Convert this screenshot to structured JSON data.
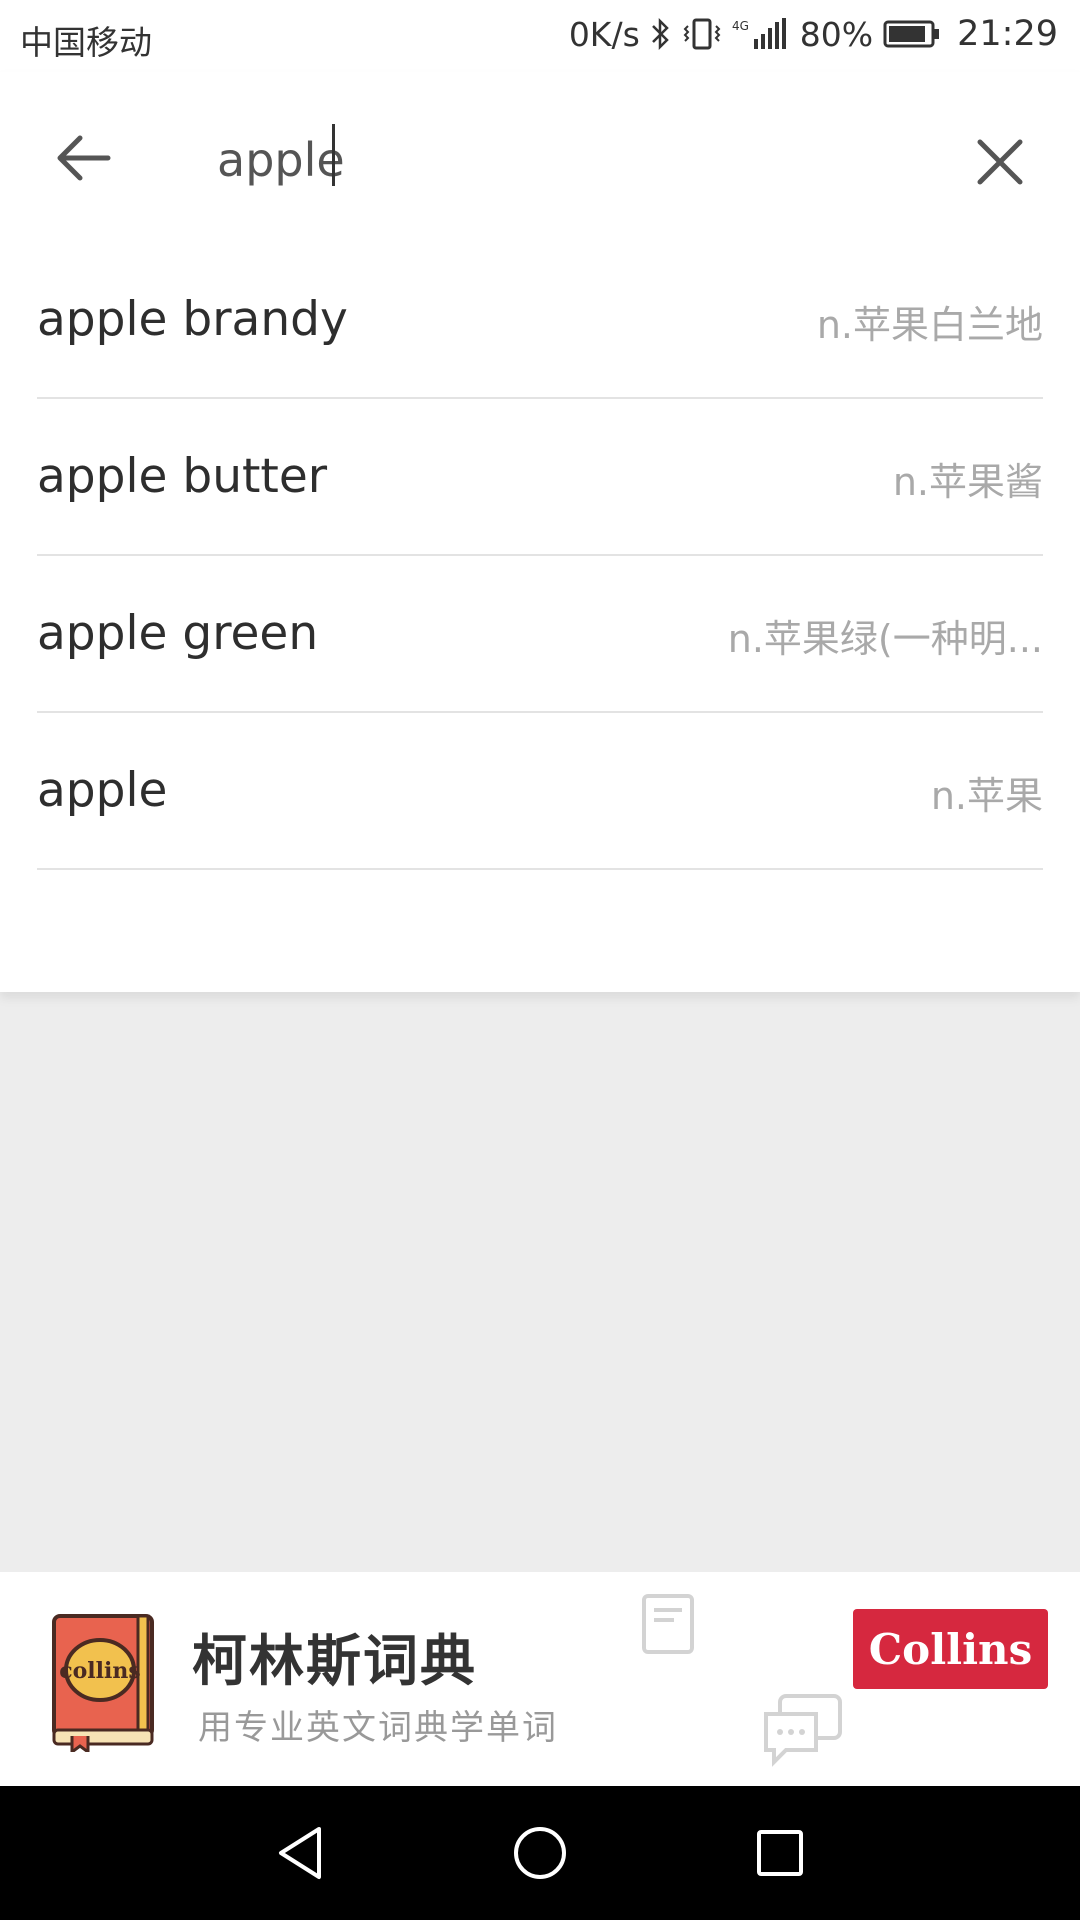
{
  "status_bar": {
    "carrier": "中国移动",
    "speed": "0K/s",
    "network": "4G",
    "battery": "80%",
    "time": "21:29"
  },
  "search": {
    "query": "apple",
    "icons": {
      "back": "arrow-left-icon",
      "clear": "close-icon"
    }
  },
  "suggestions": [
    {
      "word": "apple brandy",
      "definition": "n.苹果白兰地"
    },
    {
      "word": "apple butter",
      "definition": "n.苹果酱"
    },
    {
      "word": "apple green",
      "definition": "n.苹果绿(一种明..."
    },
    {
      "word": "apple",
      "definition": "n.苹果"
    }
  ],
  "banner": {
    "title": "柯林斯词典",
    "subtitle": "用专业英文词典学单词",
    "logo_text": "collins",
    "button_label": "Collins",
    "accent": "#d6283f"
  },
  "nav": {
    "back": "nav-back-icon",
    "home": "nav-home-icon",
    "recents": "nav-recents-icon"
  }
}
